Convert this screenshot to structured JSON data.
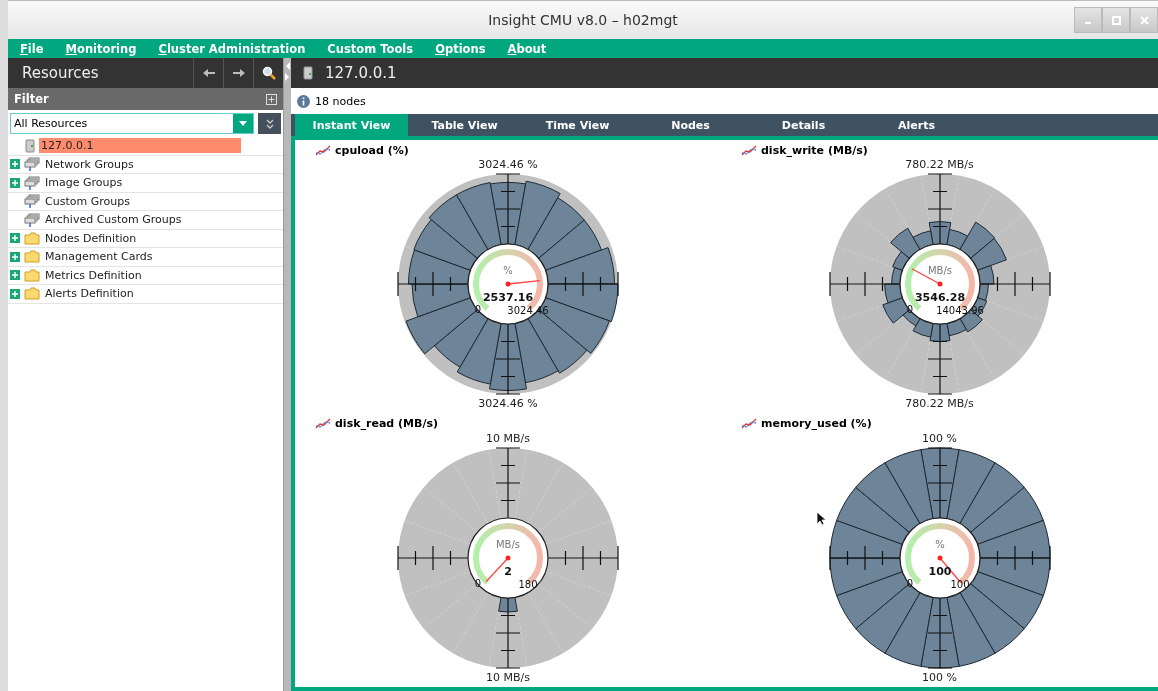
{
  "window": {
    "title": "Insight CMU v8.0 – h02mgt"
  },
  "menu": [
    {
      "label": "File",
      "mnemonic": true
    },
    {
      "label": "Monitoring",
      "mnemonic": true
    },
    {
      "label": "Cluster Administration",
      "mnemonic": true
    },
    {
      "label": "Custom Tools",
      "mnemonic": false
    },
    {
      "label": "Options",
      "mnemonic": true
    },
    {
      "label": "About",
      "mnemonic": true
    }
  ],
  "resources_panel": {
    "title": "Resources",
    "filter_label": "Filter",
    "filter_select": {
      "value": "All Resources"
    },
    "tree": [
      {
        "label": "127.0.0.1",
        "kind": "host",
        "selected": true
      },
      {
        "label": "Network Groups",
        "kind": "group",
        "expanded": false,
        "selected": false
      },
      {
        "label": "Image Groups",
        "kind": "group",
        "expanded": false,
        "selected": false
      },
      {
        "label": "Custom Groups",
        "kind": "group",
        "selected": false
      },
      {
        "label": "Archived Custom Groups",
        "kind": "group",
        "selected": false
      },
      {
        "label": "Nodes Definition",
        "kind": "folder",
        "expanded": false,
        "selected": false
      },
      {
        "label": "Management Cards",
        "kind": "folder",
        "expanded": false,
        "selected": false
      },
      {
        "label": "Metrics Definition",
        "kind": "folder",
        "expanded": false,
        "selected": false
      },
      {
        "label": "Alerts Definition",
        "kind": "folder",
        "expanded": false,
        "selected": false
      }
    ]
  },
  "host": {
    "label": "127.0.0.1"
  },
  "info": "18 nodes",
  "tabs": [
    {
      "label": "Instant View",
      "selected": true
    },
    {
      "label": "Table View",
      "selected": false
    },
    {
      "label": "Time View",
      "selected": false
    },
    {
      "label": "Nodes",
      "selected": false
    },
    {
      "label": "Details",
      "selected": false
    },
    {
      "label": "Alerts",
      "selected": false
    }
  ],
  "charts": [
    {
      "title": "cpuload (%)",
      "top_label": "3024.46 %",
      "bottom_label": "3024.46 %",
      "unit": "%",
      "value": "2537.16",
      "min": "0",
      "max": "3024.46"
    },
    {
      "title": "disk_write (MB/s)",
      "top_label": "780.22 MB/s",
      "bottom_label": "780.22 MB/s",
      "unit": "MB/s",
      "value": "3546.28",
      "min": "0",
      "max": "14043.96"
    },
    {
      "title": "disk_read (MB/s)",
      "top_label": "10 MB/s",
      "bottom_label": "10 MB/s",
      "unit": "MB/s",
      "value": "2",
      "min": "0",
      "max": "180"
    },
    {
      "title": "memory_used (%)",
      "top_label": "100 %",
      "bottom_label": "100 %",
      "unit": "%",
      "value": "100",
      "min": "0",
      "max": "100"
    }
  ]
}
